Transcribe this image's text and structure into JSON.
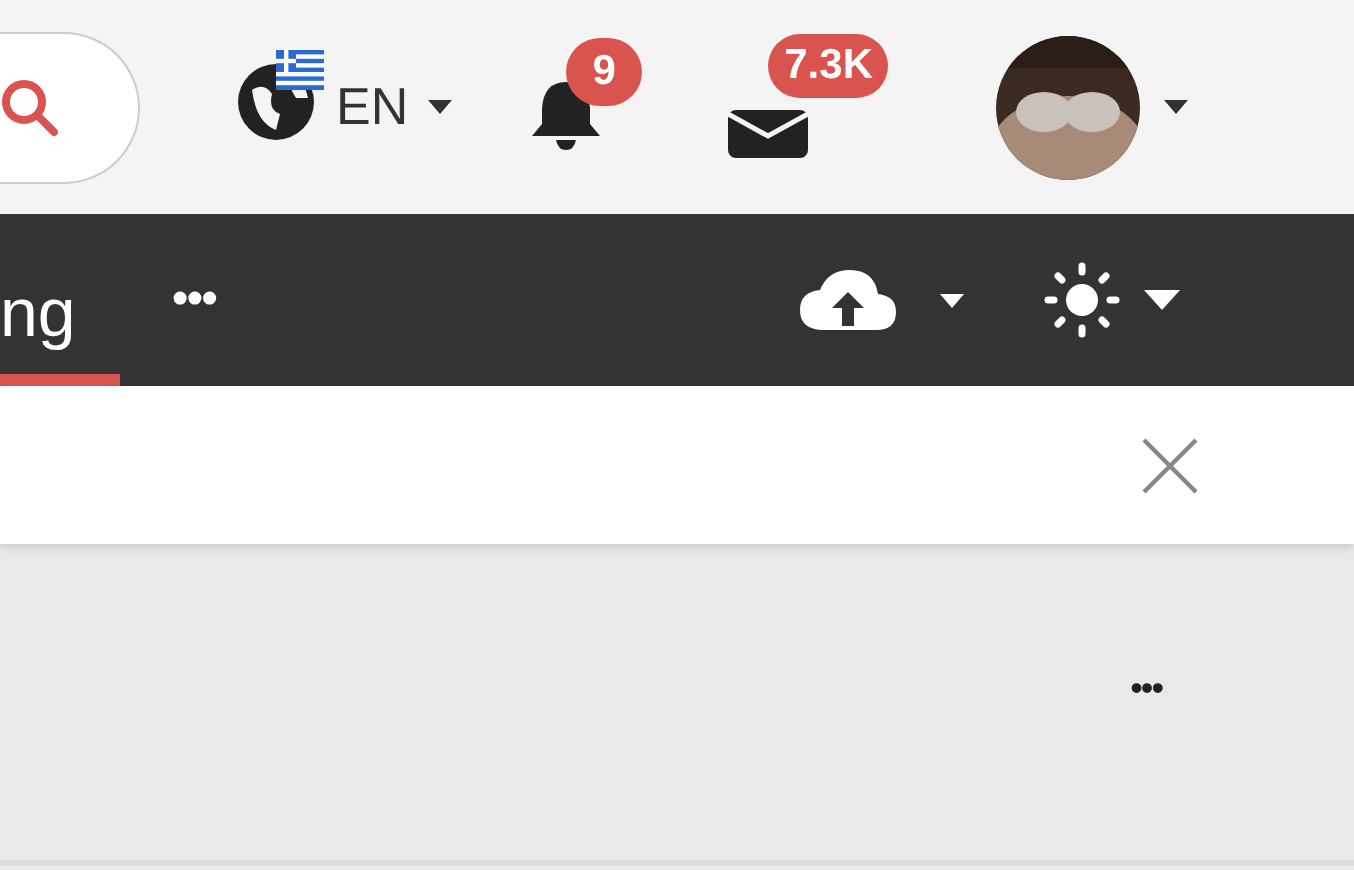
{
  "header": {
    "language": {
      "label": "EN"
    },
    "notifications": {
      "badge": "9"
    },
    "messages": {
      "badge": "7.3K"
    }
  },
  "nav": {
    "tabs": [
      {
        "label": "ng",
        "selected": true
      }
    ],
    "more": "•••"
  },
  "panel": {
    "more": "•••"
  }
}
